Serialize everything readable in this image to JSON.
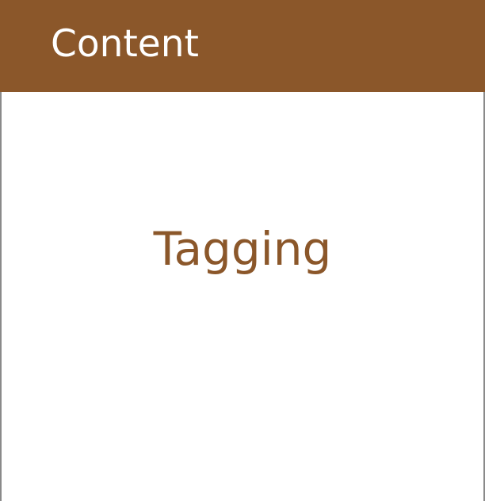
{
  "header": {
    "title": "Content"
  },
  "main": {
    "label": "Tagging"
  },
  "colors": {
    "header_background": "#8b572a",
    "header_text": "#ffffff",
    "label_text": "#8b572a",
    "border": "#8a8a8a"
  }
}
